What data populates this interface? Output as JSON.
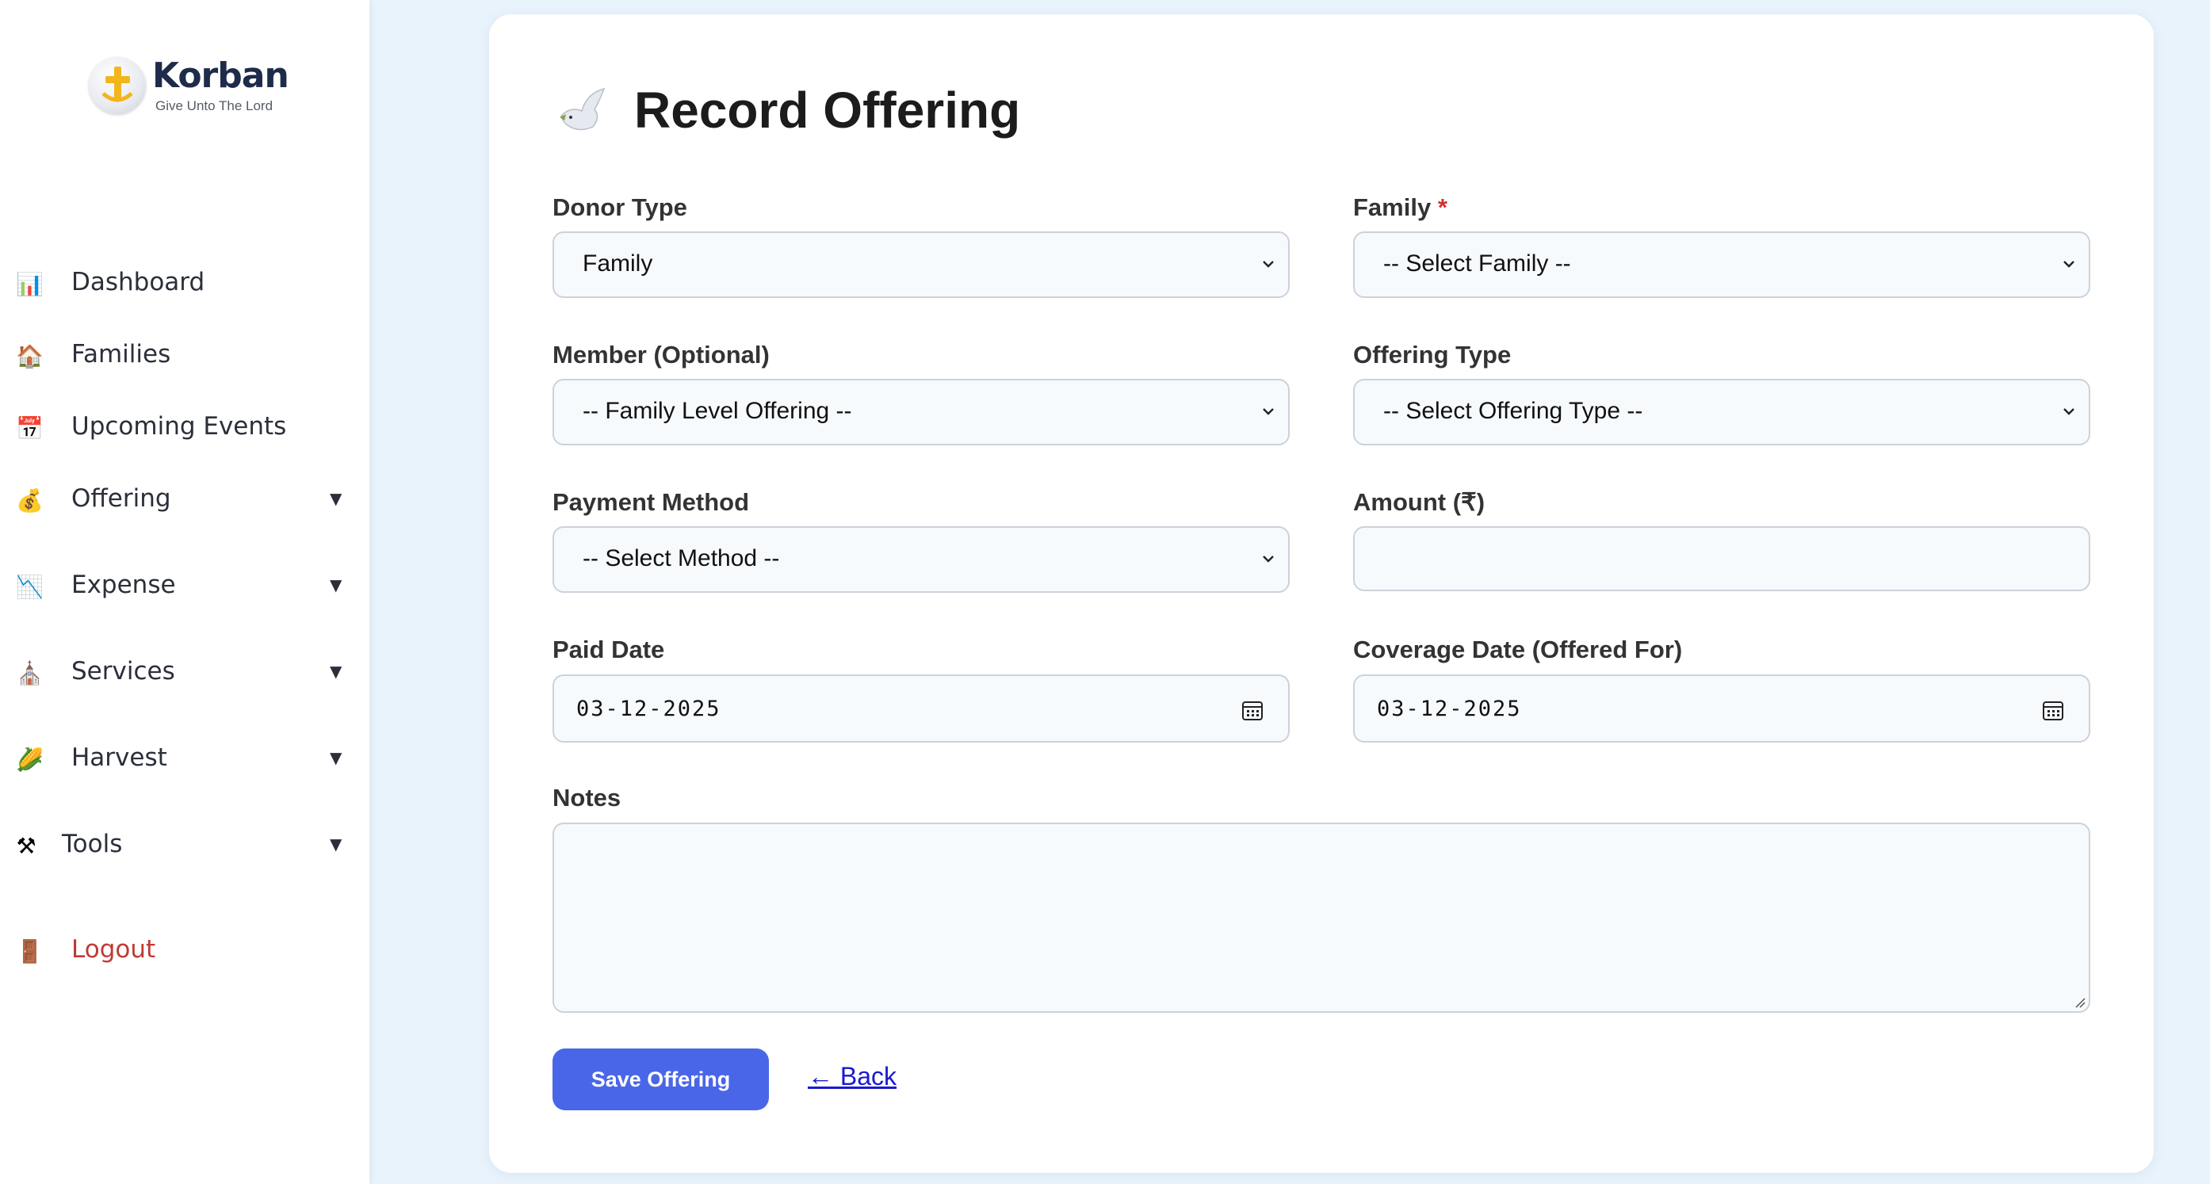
{
  "brand": {
    "name": "Korban",
    "tagline": "Give Unto The Lord"
  },
  "sidebar": {
    "items": [
      {
        "label": "Dashboard",
        "icon": "bar-chart-icon",
        "glyph": "📊",
        "has_submenu": false
      },
      {
        "label": "Families",
        "icon": "house-icon",
        "glyph": "🏠",
        "has_submenu": false
      },
      {
        "label": "Upcoming Events",
        "icon": "calendar-icon",
        "glyph": "📅",
        "has_submenu": false
      },
      {
        "label": "Offering",
        "icon": "money-bag-icon",
        "glyph": "💰",
        "has_submenu": true
      },
      {
        "label": "Expense",
        "icon": "chart-decreasing-icon",
        "glyph": "📉",
        "has_submenu": true
      },
      {
        "label": "Services",
        "icon": "church-icon",
        "glyph": "⛪",
        "has_submenu": true
      },
      {
        "label": "Harvest",
        "icon": "corn-icon",
        "glyph": "🌽",
        "has_submenu": true
      },
      {
        "label": "Tools",
        "icon": "hammer-wrench-icon",
        "glyph": "⚒",
        "has_submenu": true
      }
    ],
    "logout": {
      "label": "Logout",
      "icon": "door-icon",
      "glyph": "🚪"
    },
    "caret": "▼"
  },
  "page": {
    "title": "Record Offering",
    "title_icon": "dove-icon"
  },
  "form": {
    "donor_type": {
      "label": "Donor Type",
      "value": "Family"
    },
    "family": {
      "label": "Family",
      "required_mark": "*",
      "value": "-- Select Family --"
    },
    "member": {
      "label": "Member (Optional)",
      "value": "-- Family Level Offering --"
    },
    "offering_type": {
      "label": "Offering Type",
      "value": "-- Select Offering Type --"
    },
    "payment_method": {
      "label": "Payment Method",
      "value": "-- Select Method --"
    },
    "amount": {
      "label": "Amount (₹)",
      "value": ""
    },
    "paid_date": {
      "label": "Paid Date",
      "value": "03-12-2025"
    },
    "coverage_date": {
      "label": "Coverage Date (Offered For)",
      "value": "03-12-2025"
    },
    "notes": {
      "label": "Notes",
      "value": ""
    },
    "save_label": "Save Offering",
    "back_label": "← Back"
  },
  "colors": {
    "accent": "#4a66e8",
    "logout": "#c13a35",
    "required": "#d0312d",
    "background": "#e9f3fc"
  }
}
